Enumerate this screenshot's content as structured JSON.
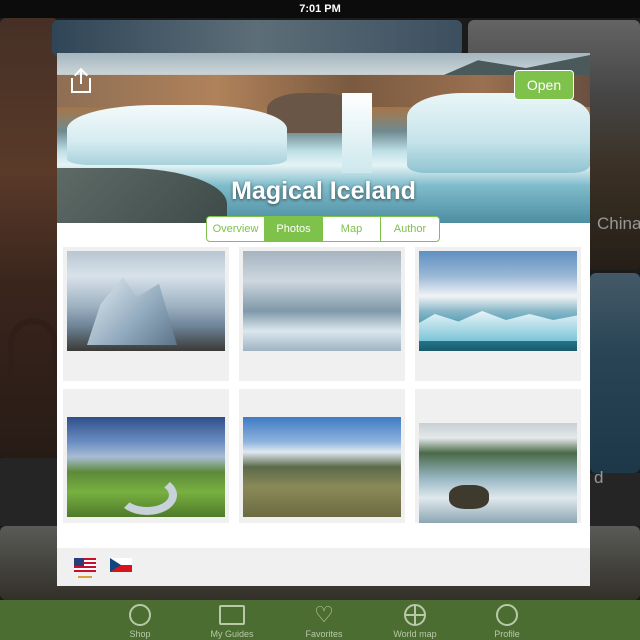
{
  "status_bar": {
    "time": "7:01 PM"
  },
  "background": {
    "captions": [
      "China",
      "d"
    ]
  },
  "guide": {
    "title": "Magical Iceland",
    "open_label": "Open",
    "share_icon": "share-icon"
  },
  "tabs": [
    {
      "label": "Overview",
      "active": false
    },
    {
      "label": "Photos",
      "active": true
    },
    {
      "label": "Map",
      "active": false
    },
    {
      "label": "Author",
      "active": false
    }
  ],
  "photos": [
    {
      "subject": "iceberg"
    },
    {
      "subject": "glacier lagoon"
    },
    {
      "subject": "ice floes on lake"
    },
    {
      "subject": "green valley with river"
    },
    {
      "subject": "fjord valley"
    },
    {
      "subject": "rocks in river"
    }
  ],
  "languages": [
    {
      "flag": "us-flag-icon",
      "selected": true
    },
    {
      "flag": "czech-flag-icon",
      "selected": false
    }
  ],
  "tab_bar": [
    {
      "label": "Shop",
      "icon": "shop-icon"
    },
    {
      "label": "My Guides",
      "icon": "guides-icon"
    },
    {
      "label": "Favorites",
      "icon": "heart-icon"
    },
    {
      "label": "World map",
      "icon": "globe-icon"
    },
    {
      "label": "Profile",
      "icon": "profile-icon"
    }
  ],
  "colors": {
    "accent_green": "#7ec14b",
    "tab_bar_green": "#4b6d31"
  }
}
